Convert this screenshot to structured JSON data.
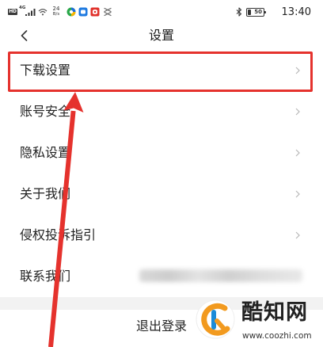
{
  "status_bar": {
    "hd": "HD",
    "network": "4G",
    "speed_value": "24",
    "speed_unit": "B/s",
    "battery_level": "50",
    "time": "13:40",
    "icons": [
      "signal-icon",
      "wifi-icon",
      "colorful-circle-app-icon",
      "blue-chat-app-icon",
      "red-app-icon",
      "gray-symbol-app-icon",
      "bluetooth-icon",
      "battery-icon"
    ]
  },
  "header": {
    "back_icon": "chevron-left-icon",
    "title": "设置"
  },
  "settings": {
    "chevron_icon": "chevron-right-icon",
    "items": [
      {
        "label": "下载设置",
        "has_chevron": true
      },
      {
        "label": "账号安全",
        "has_chevron": true
      },
      {
        "label": "隐私设置",
        "has_chevron": true
      },
      {
        "label": "关于我们",
        "has_chevron": true
      },
      {
        "label": "侵权投诉指引",
        "has_chevron": true
      },
      {
        "label": "联系我们",
        "has_chevron": false
      }
    ]
  },
  "logout": {
    "label": "退出登录"
  },
  "annotation": {
    "highlighted_item_index": 0
  },
  "watermark": {
    "name": "酷知网",
    "url": "www.coozhi.com",
    "logo_icon": "coozhi-logo-icon"
  },
  "colors": {
    "annotation": "#e5322d",
    "text": "#222222",
    "chevron": "#b8b8b8",
    "section_gap": "#f2f2f2",
    "logo_orange": "#f29a1f",
    "logo_blue": "#1b8bd8"
  }
}
